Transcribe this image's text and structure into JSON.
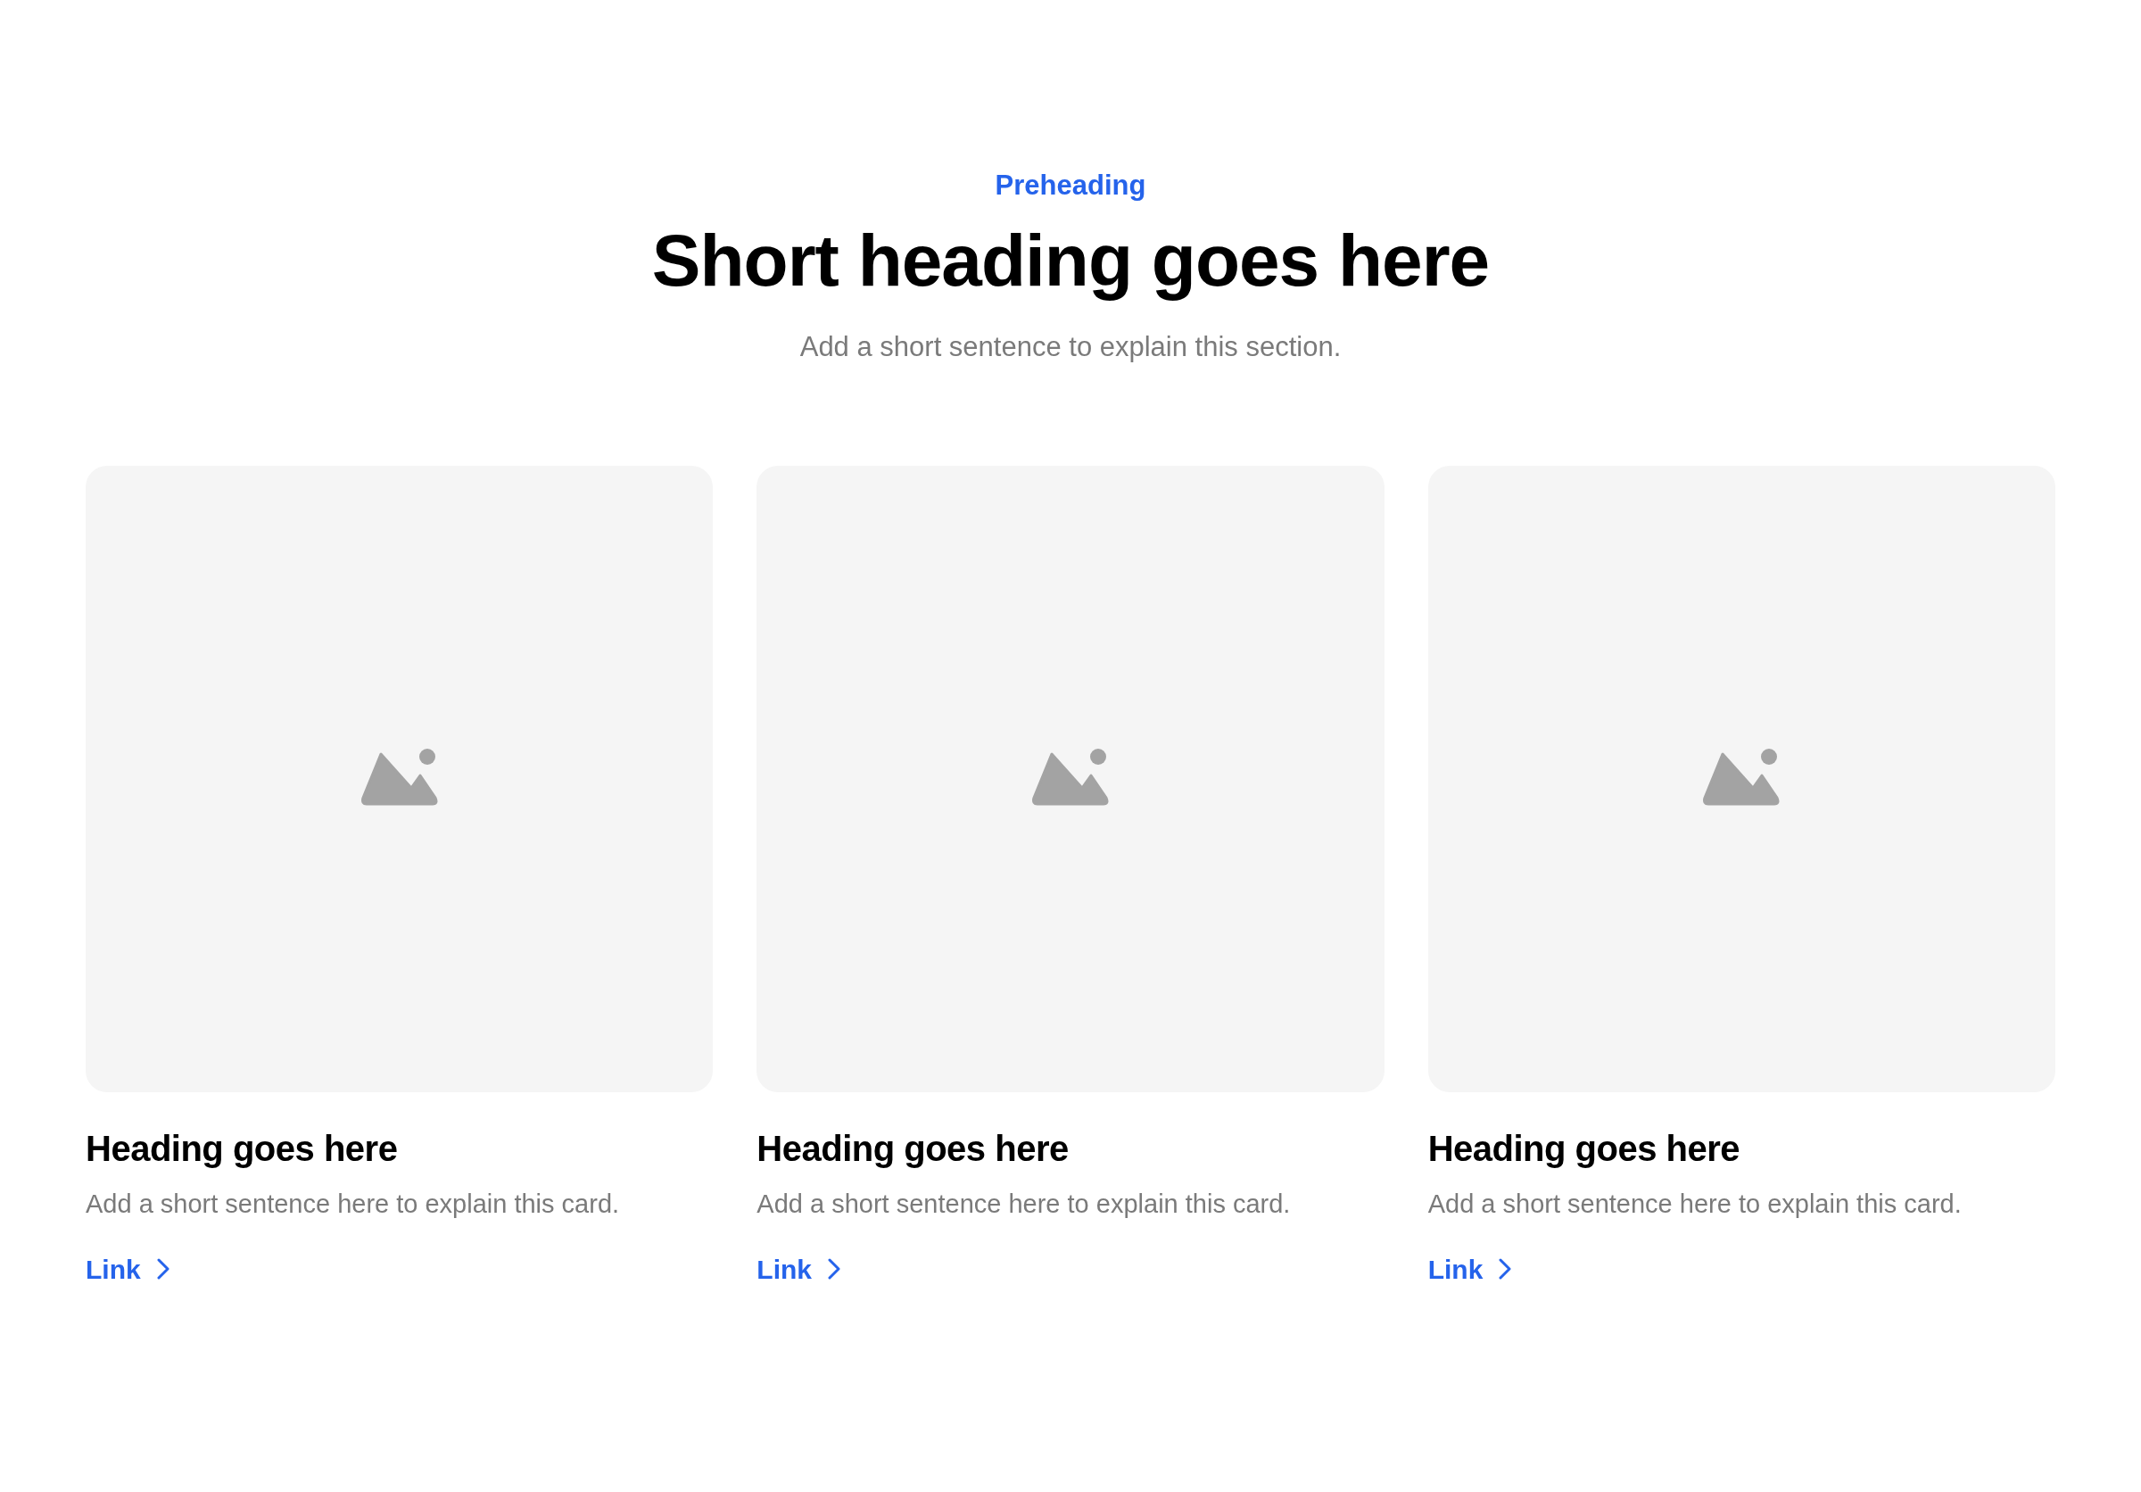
{
  "header": {
    "preheading": "Preheading",
    "heading": "Short heading goes here",
    "subheading": "Add a short sentence to explain this section."
  },
  "cards": [
    {
      "heading": "Heading goes here",
      "text": "Add a short sentence here to explain this card.",
      "link": "Link"
    },
    {
      "heading": "Heading goes here",
      "text": "Add a short sentence here to explain this card.",
      "link": "Link"
    },
    {
      "heading": "Heading goes here",
      "text": "Add a short sentence here to explain this card.",
      "link": "Link"
    }
  ]
}
